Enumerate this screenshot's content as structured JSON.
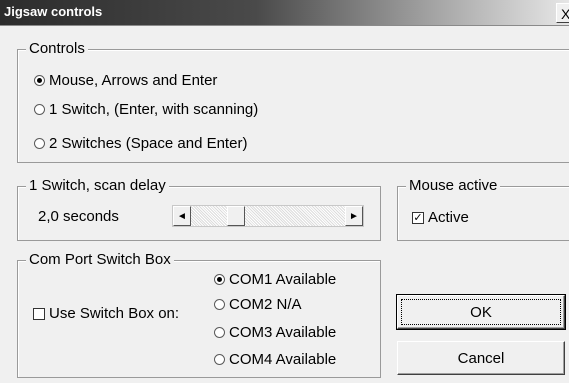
{
  "window": {
    "title": "Jigsaw controls",
    "close_glyph": "X"
  },
  "controls_group": {
    "legend": "Controls",
    "options": [
      {
        "label": "Mouse, Arrows and Enter",
        "checked": true
      },
      {
        "label": "1 Switch,  (Enter, with scanning)",
        "checked": false
      },
      {
        "label": "2 Switches (Space and Enter)",
        "checked": false
      }
    ]
  },
  "scan_delay_group": {
    "legend": "1 Switch, scan delay",
    "value_text": "2,0 seconds",
    "left_arrow": "◄",
    "right_arrow": "►"
  },
  "mouse_group": {
    "legend": "Mouse active",
    "checkbox_label": "Active",
    "checked": true,
    "check_glyph": "✓"
  },
  "com_group": {
    "legend": "Com Port Switch Box",
    "checkbox_label": "Use Switch Box on:",
    "checked": false,
    "ports": [
      {
        "label": "COM1 Available",
        "checked": true
      },
      {
        "label": "COM2 N/A",
        "checked": false
      },
      {
        "label": "COM3 Available",
        "checked": false
      },
      {
        "label": "COM4 Available",
        "checked": false
      }
    ]
  },
  "buttons": {
    "ok": "OK",
    "cancel": "Cancel"
  }
}
